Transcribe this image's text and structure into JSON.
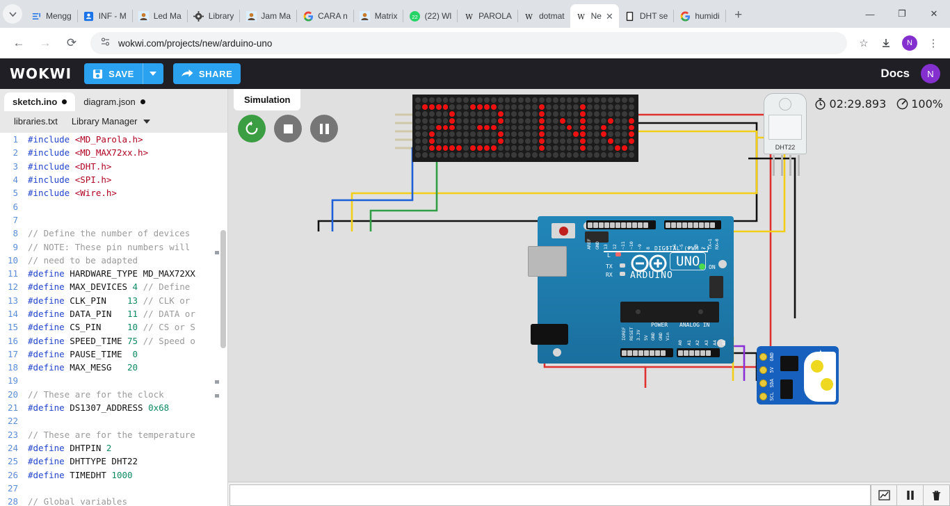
{
  "browser": {
    "tabs": [
      {
        "label": "Mengg",
        "favicon": "doc-icon"
      },
      {
        "label": "INF - M",
        "favicon": "contact-icon"
      },
      {
        "label": "Led Ma",
        "favicon": "person-icon"
      },
      {
        "label": "Library",
        "favicon": "gear-icon"
      },
      {
        "label": "Jam Ma",
        "favicon": "person-icon"
      },
      {
        "label": "CARA n",
        "favicon": "google-icon"
      },
      {
        "label": "Matrix",
        "favicon": "person-icon"
      },
      {
        "label": "(22) Wl",
        "favicon": "whatsapp-icon"
      },
      {
        "label": "PAROLA",
        "favicon": "wokwi-icon"
      },
      {
        "label": "dotmat",
        "favicon": "wokwi-icon"
      },
      {
        "label": "Ne",
        "favicon": "wokwi-icon",
        "active": true
      },
      {
        "label": "DHT se",
        "favicon": "book-icon"
      },
      {
        "label": "humidi",
        "favicon": "google-icon"
      }
    ],
    "new_tab_label": "+",
    "window": {
      "minimize": "—",
      "maximize": "❐",
      "close": "✕"
    },
    "nav": {
      "back": "←",
      "forward": "→",
      "reload": "⟳"
    },
    "url": "wokwi.com/projects/new/arduino-uno",
    "bookmark_star": "☆",
    "download_icon": "download-icon",
    "profile_initial": "N",
    "menu_icon": "⋮"
  },
  "wokwi": {
    "logo": "WOKWI",
    "save_label": "SAVE",
    "save_caret": "▼",
    "share_label": "SHARE",
    "docs_label": "Docs",
    "profile_initial": "N"
  },
  "files": {
    "tab1": "sketch.ino",
    "tab2": "diagram.json",
    "tab3": "libraries.txt",
    "library_manager": "Library Manager"
  },
  "simulation": {
    "panel_label": "Simulation",
    "restart_title": "restart",
    "stop_title": "stop",
    "pause_title": "pause",
    "timer": "02:29.893",
    "speed": "100%"
  },
  "serial": {
    "input_value": "",
    "placeholder": "",
    "plot_icon": "chart-icon",
    "pause_icon": "pause-icon",
    "clear_icon": "trash-icon"
  },
  "diagram": {
    "board_label": "UNO",
    "board_brand": "ARDUINO",
    "led_l": "L",
    "tx": "TX",
    "rx": "RX",
    "on": "ON",
    "digital_label": "DIGITAL (PWM ~)",
    "power_label": "POWER",
    "analog_label": "ANALOG IN",
    "digital_pins": [
      "AREF",
      "GND",
      "13",
      "12",
      "~11",
      "~10",
      "~9",
      "8"
    ],
    "digital_pins_right": [
      "7",
      "~6",
      "~5",
      "4",
      "~3",
      "2",
      "TX→1",
      "RX←0"
    ],
    "power_pins": [
      "IOREF",
      "RESET",
      "3.3V",
      "5V",
      "GND",
      "GND",
      "Vin"
    ],
    "analog_pins": [
      "A0",
      "A1",
      "A2",
      "A3",
      "A4",
      "A5"
    ],
    "dht_label": "DHT22",
    "rtc_pins": [
      "GND",
      "5V",
      "SDA",
      "SCL"
    ],
    "matrix_text": "23 NU"
  },
  "code": {
    "lines": [
      {
        "n": 1,
        "tokens": [
          {
            "t": "#include",
            "c": "pre"
          },
          {
            "t": " ",
            "c": "id"
          },
          {
            "t": "<MD_Parola.h>",
            "c": "inc"
          }
        ]
      },
      {
        "n": 2,
        "tokens": [
          {
            "t": "#include",
            "c": "pre"
          },
          {
            "t": " ",
            "c": "id"
          },
          {
            "t": "<MD_MAX72xx.h>",
            "c": "inc"
          }
        ]
      },
      {
        "n": 3,
        "tokens": [
          {
            "t": "#include",
            "c": "pre"
          },
          {
            "t": " ",
            "c": "id"
          },
          {
            "t": "<DHT.h>",
            "c": "inc"
          }
        ]
      },
      {
        "n": 4,
        "tokens": [
          {
            "t": "#include",
            "c": "pre"
          },
          {
            "t": " ",
            "c": "id"
          },
          {
            "t": "<SPI.h>",
            "c": "inc"
          }
        ]
      },
      {
        "n": 5,
        "tokens": [
          {
            "t": "#include",
            "c": "pre"
          },
          {
            "t": " ",
            "c": "id"
          },
          {
            "t": "<Wire.h>",
            "c": "inc"
          }
        ]
      },
      {
        "n": 6,
        "tokens": []
      },
      {
        "n": 7,
        "tokens": []
      },
      {
        "n": 8,
        "tokens": [
          {
            "t": "// Define the number of devices",
            "c": "cmt"
          }
        ]
      },
      {
        "n": 9,
        "tokens": [
          {
            "t": "// NOTE: These pin numbers will",
            "c": "cmt"
          }
        ]
      },
      {
        "n": 10,
        "tokens": [
          {
            "t": "// need to be adapted",
            "c": "cmt"
          }
        ]
      },
      {
        "n": 11,
        "tokens": [
          {
            "t": "#define",
            "c": "pre"
          },
          {
            "t": " HARDWARE_TYPE MD_MAX72XX",
            "c": "id"
          }
        ]
      },
      {
        "n": 12,
        "tokens": [
          {
            "t": "#define",
            "c": "pre"
          },
          {
            "t": " MAX_DEVICES ",
            "c": "id"
          },
          {
            "t": "4",
            "c": "num"
          },
          {
            "t": " ",
            "c": "id"
          },
          {
            "t": "// Define",
            "c": "cmt"
          }
        ]
      },
      {
        "n": 13,
        "tokens": [
          {
            "t": "#define",
            "c": "pre"
          },
          {
            "t": " CLK_PIN    ",
            "c": "id"
          },
          {
            "t": "13",
            "c": "num"
          },
          {
            "t": " ",
            "c": "id"
          },
          {
            "t": "// CLK or",
            "c": "cmt"
          }
        ]
      },
      {
        "n": 14,
        "tokens": [
          {
            "t": "#define",
            "c": "pre"
          },
          {
            "t": " DATA_PIN   ",
            "c": "id"
          },
          {
            "t": "11",
            "c": "num"
          },
          {
            "t": " ",
            "c": "id"
          },
          {
            "t": "// DATA or",
            "c": "cmt"
          }
        ]
      },
      {
        "n": 15,
        "tokens": [
          {
            "t": "#define",
            "c": "pre"
          },
          {
            "t": " CS_PIN     ",
            "c": "id"
          },
          {
            "t": "10",
            "c": "num"
          },
          {
            "t": " ",
            "c": "id"
          },
          {
            "t": "// CS or S",
            "c": "cmt"
          }
        ]
      },
      {
        "n": 16,
        "tokens": [
          {
            "t": "#define",
            "c": "pre"
          },
          {
            "t": " SPEED_TIME ",
            "c": "id"
          },
          {
            "t": "75",
            "c": "num"
          },
          {
            "t": " ",
            "c": "id"
          },
          {
            "t": "// Speed o",
            "c": "cmt"
          }
        ]
      },
      {
        "n": 17,
        "tokens": [
          {
            "t": "#define",
            "c": "pre"
          },
          {
            "t": " PAUSE_TIME  ",
            "c": "id"
          },
          {
            "t": "0",
            "c": "num"
          }
        ]
      },
      {
        "n": 18,
        "tokens": [
          {
            "t": "#define",
            "c": "pre"
          },
          {
            "t": " MAX_MESG   ",
            "c": "id"
          },
          {
            "t": "20",
            "c": "num"
          }
        ]
      },
      {
        "n": 19,
        "tokens": []
      },
      {
        "n": 20,
        "tokens": [
          {
            "t": "// These are for the clock",
            "c": "cmt"
          }
        ]
      },
      {
        "n": 21,
        "tokens": [
          {
            "t": "#define",
            "c": "pre"
          },
          {
            "t": " DS1307_ADDRESS ",
            "c": "id"
          },
          {
            "t": "0x68",
            "c": "num"
          }
        ]
      },
      {
        "n": 22,
        "tokens": []
      },
      {
        "n": 23,
        "tokens": [
          {
            "t": "// These are for the temperature",
            "c": "cmt"
          }
        ]
      },
      {
        "n": 24,
        "tokens": [
          {
            "t": "#define",
            "c": "pre"
          },
          {
            "t": " DHTPIN ",
            "c": "id"
          },
          {
            "t": "2",
            "c": "num"
          }
        ]
      },
      {
        "n": 25,
        "tokens": [
          {
            "t": "#define",
            "c": "pre"
          },
          {
            "t": " DHTTYPE DHT22",
            "c": "id"
          }
        ]
      },
      {
        "n": 26,
        "tokens": [
          {
            "t": "#define",
            "c": "pre"
          },
          {
            "t": " TIMEDHT ",
            "c": "id"
          },
          {
            "t": "1000",
            "c": "num"
          }
        ]
      },
      {
        "n": 27,
        "tokens": []
      },
      {
        "n": 28,
        "tokens": [
          {
            "t": "// Global variables",
            "c": "cmt"
          }
        ]
      }
    ]
  },
  "colors": {
    "accent": "#2aa2ef",
    "header_bg": "#1f1f25",
    "led_on": "#ee1111",
    "led_off": "#3a3a3a",
    "board": "#1f7aab",
    "sim_bg": "#e0e0e0",
    "green_btn": "#3c9e42"
  },
  "matrix_pattern": [
    "00000000000000000000000000000000",
    "01111000111100000010000010000000",
    "00000100000010000010000010000000",
    "00000100000010000010010010001001",
    "00011100011100000010001010010001",
    "00100000000010000010000110010001",
    "00100000000010000010000010001001",
    "00111110111100000010000010000110",
    "00000000000000000000000000000000"
  ]
}
